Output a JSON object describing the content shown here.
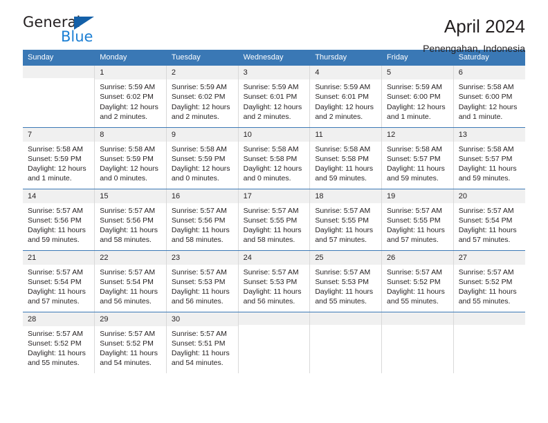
{
  "brand": {
    "name_part1": "General",
    "name_part2": "Blue",
    "triangle_color": "#1460a8",
    "blue_color": "#1b7fd4"
  },
  "header": {
    "title": "April 2024",
    "location": "Penengahan, Indonesia"
  },
  "theme": {
    "header_blue": "#3a78b5",
    "daynum_background": "#f0f0f0",
    "text_color": "#231f20",
    "cell_border": "#d9d9d9"
  },
  "weekdays": [
    "Sunday",
    "Monday",
    "Tuesday",
    "Wednesday",
    "Thursday",
    "Friday",
    "Saturday"
  ],
  "labels": {
    "sunrise_prefix": "Sunrise:",
    "sunset_prefix": "Sunset:",
    "daylight_prefix": "Daylight:"
  },
  "weeks": [
    [
      {
        "day": "",
        "blank": true,
        "line1": "",
        "line2": "",
        "line3": "",
        "line4": ""
      },
      {
        "day": "1",
        "line1": "Sunrise: 5:59 AM",
        "line2": "Sunset: 6:02 PM",
        "line3": "Daylight: 12 hours",
        "line4": "and 2 minutes."
      },
      {
        "day": "2",
        "line1": "Sunrise: 5:59 AM",
        "line2": "Sunset: 6:02 PM",
        "line3": "Daylight: 12 hours",
        "line4": "and 2 minutes."
      },
      {
        "day": "3",
        "line1": "Sunrise: 5:59 AM",
        "line2": "Sunset: 6:01 PM",
        "line3": "Daylight: 12 hours",
        "line4": "and 2 minutes."
      },
      {
        "day": "4",
        "line1": "Sunrise: 5:59 AM",
        "line2": "Sunset: 6:01 PM",
        "line3": "Daylight: 12 hours",
        "line4": "and 2 minutes."
      },
      {
        "day": "5",
        "line1": "Sunrise: 5:59 AM",
        "line2": "Sunset: 6:00 PM",
        "line3": "Daylight: 12 hours",
        "line4": "and 1 minute."
      },
      {
        "day": "6",
        "line1": "Sunrise: 5:58 AM",
        "line2": "Sunset: 6:00 PM",
        "line3": "Daylight: 12 hours",
        "line4": "and 1 minute."
      }
    ],
    [
      {
        "day": "7",
        "line1": "Sunrise: 5:58 AM",
        "line2": "Sunset: 5:59 PM",
        "line3": "Daylight: 12 hours",
        "line4": "and 1 minute."
      },
      {
        "day": "8",
        "line1": "Sunrise: 5:58 AM",
        "line2": "Sunset: 5:59 PM",
        "line3": "Daylight: 12 hours",
        "line4": "and 0 minutes."
      },
      {
        "day": "9",
        "line1": "Sunrise: 5:58 AM",
        "line2": "Sunset: 5:59 PM",
        "line3": "Daylight: 12 hours",
        "line4": "and 0 minutes."
      },
      {
        "day": "10",
        "line1": "Sunrise: 5:58 AM",
        "line2": "Sunset: 5:58 PM",
        "line3": "Daylight: 12 hours",
        "line4": "and 0 minutes."
      },
      {
        "day": "11",
        "line1": "Sunrise: 5:58 AM",
        "line2": "Sunset: 5:58 PM",
        "line3": "Daylight: 11 hours",
        "line4": "and 59 minutes."
      },
      {
        "day": "12",
        "line1": "Sunrise: 5:58 AM",
        "line2": "Sunset: 5:57 PM",
        "line3": "Daylight: 11 hours",
        "line4": "and 59 minutes."
      },
      {
        "day": "13",
        "line1": "Sunrise: 5:58 AM",
        "line2": "Sunset: 5:57 PM",
        "line3": "Daylight: 11 hours",
        "line4": "and 59 minutes."
      }
    ],
    [
      {
        "day": "14",
        "line1": "Sunrise: 5:57 AM",
        "line2": "Sunset: 5:56 PM",
        "line3": "Daylight: 11 hours",
        "line4": "and 59 minutes."
      },
      {
        "day": "15",
        "line1": "Sunrise: 5:57 AM",
        "line2": "Sunset: 5:56 PM",
        "line3": "Daylight: 11 hours",
        "line4": "and 58 minutes."
      },
      {
        "day": "16",
        "line1": "Sunrise: 5:57 AM",
        "line2": "Sunset: 5:56 PM",
        "line3": "Daylight: 11 hours",
        "line4": "and 58 minutes."
      },
      {
        "day": "17",
        "line1": "Sunrise: 5:57 AM",
        "line2": "Sunset: 5:55 PM",
        "line3": "Daylight: 11 hours",
        "line4": "and 58 minutes."
      },
      {
        "day": "18",
        "line1": "Sunrise: 5:57 AM",
        "line2": "Sunset: 5:55 PM",
        "line3": "Daylight: 11 hours",
        "line4": "and 57 minutes."
      },
      {
        "day": "19",
        "line1": "Sunrise: 5:57 AM",
        "line2": "Sunset: 5:55 PM",
        "line3": "Daylight: 11 hours",
        "line4": "and 57 minutes."
      },
      {
        "day": "20",
        "line1": "Sunrise: 5:57 AM",
        "line2": "Sunset: 5:54 PM",
        "line3": "Daylight: 11 hours",
        "line4": "and 57 minutes."
      }
    ],
    [
      {
        "day": "21",
        "line1": "Sunrise: 5:57 AM",
        "line2": "Sunset: 5:54 PM",
        "line3": "Daylight: 11 hours",
        "line4": "and 57 minutes."
      },
      {
        "day": "22",
        "line1": "Sunrise: 5:57 AM",
        "line2": "Sunset: 5:54 PM",
        "line3": "Daylight: 11 hours",
        "line4": "and 56 minutes."
      },
      {
        "day": "23",
        "line1": "Sunrise: 5:57 AM",
        "line2": "Sunset: 5:53 PM",
        "line3": "Daylight: 11 hours",
        "line4": "and 56 minutes."
      },
      {
        "day": "24",
        "line1": "Sunrise: 5:57 AM",
        "line2": "Sunset: 5:53 PM",
        "line3": "Daylight: 11 hours",
        "line4": "and 56 minutes."
      },
      {
        "day": "25",
        "line1": "Sunrise: 5:57 AM",
        "line2": "Sunset: 5:53 PM",
        "line3": "Daylight: 11 hours",
        "line4": "and 55 minutes."
      },
      {
        "day": "26",
        "line1": "Sunrise: 5:57 AM",
        "line2": "Sunset: 5:52 PM",
        "line3": "Daylight: 11 hours",
        "line4": "and 55 minutes."
      },
      {
        "day": "27",
        "line1": "Sunrise: 5:57 AM",
        "line2": "Sunset: 5:52 PM",
        "line3": "Daylight: 11 hours",
        "line4": "and 55 minutes."
      }
    ],
    [
      {
        "day": "28",
        "line1": "Sunrise: 5:57 AM",
        "line2": "Sunset: 5:52 PM",
        "line3": "Daylight: 11 hours",
        "line4": "and 55 minutes."
      },
      {
        "day": "29",
        "line1": "Sunrise: 5:57 AM",
        "line2": "Sunset: 5:52 PM",
        "line3": "Daylight: 11 hours",
        "line4": "and 54 minutes."
      },
      {
        "day": "30",
        "line1": "Sunrise: 5:57 AM",
        "line2": "Sunset: 5:51 PM",
        "line3": "Daylight: 11 hours",
        "line4": "and 54 minutes."
      },
      {
        "day": "",
        "blank": true,
        "line1": "",
        "line2": "",
        "line3": "",
        "line4": ""
      },
      {
        "day": "",
        "blank": true,
        "line1": "",
        "line2": "",
        "line3": "",
        "line4": ""
      },
      {
        "day": "",
        "blank": true,
        "line1": "",
        "line2": "",
        "line3": "",
        "line4": ""
      },
      {
        "day": "",
        "blank": true,
        "line1": "",
        "line2": "",
        "line3": "",
        "line4": ""
      }
    ]
  ]
}
